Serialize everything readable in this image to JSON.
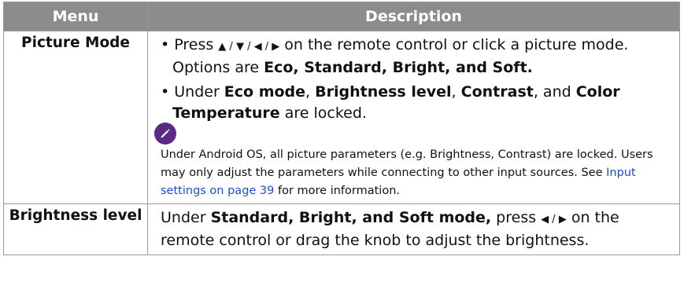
{
  "header": {
    "menu": "Menu",
    "description": "Description"
  },
  "rows": [
    {
      "menu": "Picture Mode",
      "bullet1": {
        "prefix": "• Press ",
        "arrows": "▲ / ▼ / ◀ / ▶",
        "middle": " on the remote control or click a picture mode. Options are ",
        "bold": "Eco, Standard, Bright, and Soft."
      },
      "bullet2": {
        "b0": "• Under ",
        "b1": "Eco mode",
        "b2": ", ",
        "b3": "Brightness level",
        "b4": ", ",
        "b5": "Contrast",
        "b6": ", and ",
        "b7": "Color Temperature",
        "b8": " are locked."
      },
      "note": {
        "icon": "pencil-icon",
        "text1": "Under Android OS, all picture parameters (e.g. Brightness, Contrast) are locked. Users may only adjust the parameters while connecting to other input sources. See ",
        "link": "Input settings on page 39",
        "text2": " for more information."
      }
    },
    {
      "menu": "Brightness level",
      "p": {
        "t0": "Under ",
        "bold": "Standard, Bright, and Soft mode,",
        "t1": " press ",
        "arrows": "◀ / ▶",
        "t2": " on the remote control or drag the knob to adjust the brightness."
      }
    }
  ],
  "colors": {
    "header_bg": "#8c8c8c",
    "note_icon": "#5a2a86",
    "link": "#1b4fd1"
  }
}
